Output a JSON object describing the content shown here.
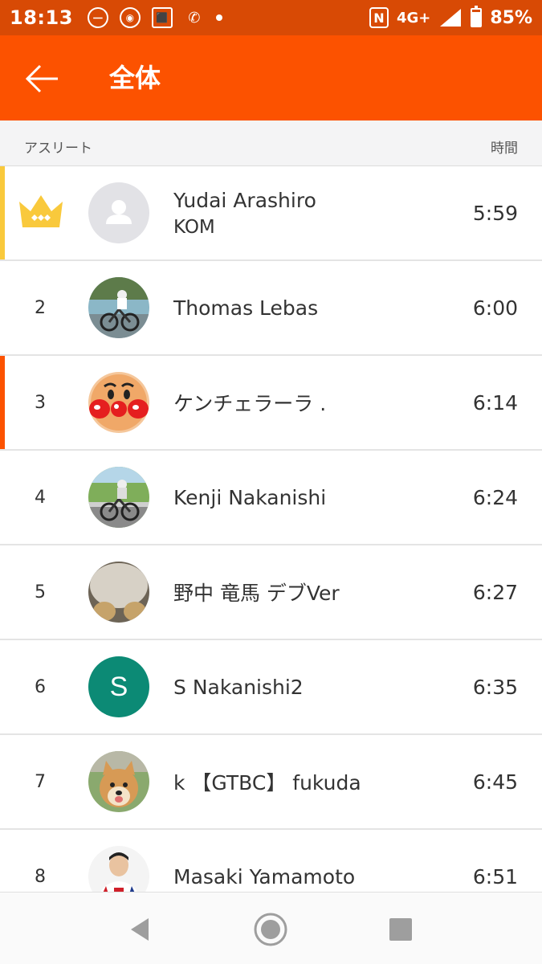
{
  "status_bar": {
    "time": "18:13",
    "network": "4G+",
    "battery_text": "85%",
    "battery_level": 0.85,
    "icons": [
      "nfc-icon",
      "signal-icon",
      "battery-icon"
    ]
  },
  "header": {
    "title": "全体",
    "back_icon": "arrow-left-icon"
  },
  "columns": {
    "athlete": "アスリート",
    "time": "時間"
  },
  "leaderboard": [
    {
      "rank": "",
      "name": "Yudai Arashiro",
      "sub": "KOM",
      "time": "5:59",
      "avatar": "placeholder",
      "crown": true,
      "highlight": "#f9c93c"
    },
    {
      "rank": "2",
      "name": "Thomas Lebas",
      "sub": "",
      "time": "6:00",
      "avatar": "cyclist-photo"
    },
    {
      "rank": "3",
      "name": "ケンチェラーラ .",
      "sub": "",
      "time": "6:14",
      "avatar": "anpanman",
      "highlight": "#fc5200"
    },
    {
      "rank": "4",
      "name": "Kenji Nakanishi",
      "sub": "",
      "time": "6:24",
      "avatar": "cyclist-photo-green"
    },
    {
      "rank": "5",
      "name": "野中 竜馬 デブVer",
      "sub": "",
      "time": "6:27",
      "avatar": "gray-photo"
    },
    {
      "rank": "6",
      "name": "S Nakanishi2",
      "sub": "",
      "time": "6:35",
      "avatar": "initial",
      "initial": "S",
      "avatar_color": "#0c8a75"
    },
    {
      "rank": "7",
      "name": "k 【GTBC】 fukuda",
      "sub": "",
      "time": "6:45",
      "avatar": "dog-photo"
    },
    {
      "rank": "8",
      "name": "Masaki Yamamoto",
      "sub": "",
      "time": "6:51",
      "avatar": "rider-portrait"
    }
  ],
  "colors": {
    "accent": "#fc5200",
    "status_bar": "#d84a05",
    "crown": "#f9c93c"
  },
  "nav": {
    "back": "nav-back-icon",
    "home": "nav-home-icon",
    "recents": "nav-recents-icon"
  }
}
